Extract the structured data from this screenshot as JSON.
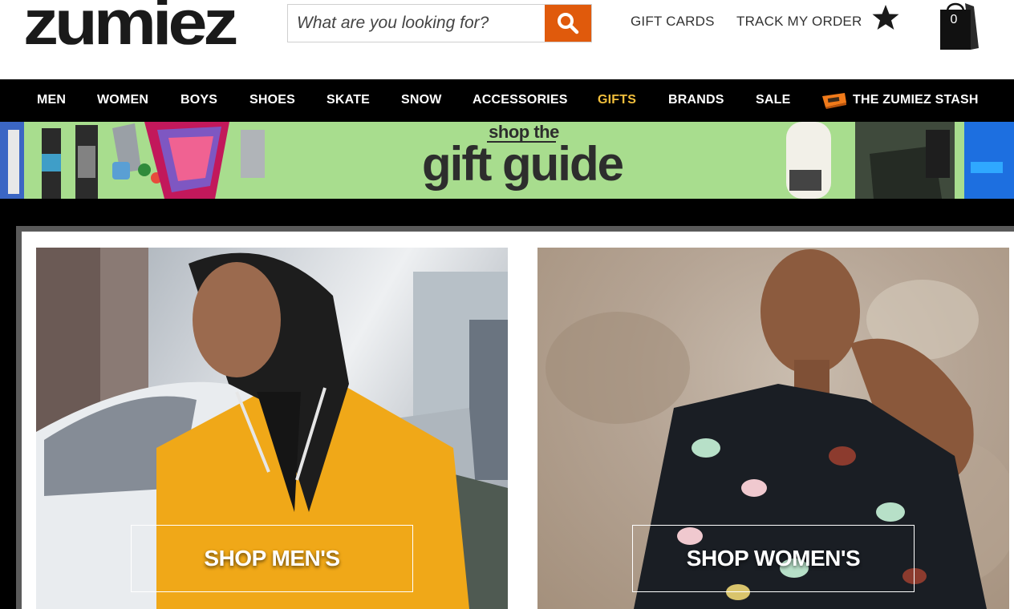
{
  "header": {
    "logo": "zumiez",
    "search_placeholder": "What are you looking for?",
    "links": [
      "GIFT CARDS",
      "TRACK MY ORDER"
    ],
    "cart_count": "0"
  },
  "nav": {
    "items": [
      "MEN",
      "WOMEN",
      "BOYS",
      "SHOES",
      "SKATE",
      "SNOW",
      "ACCESSORIES",
      "GIFTS",
      "BRANDS",
      "SALE",
      "THE ZUMIEZ STASH"
    ]
  },
  "banner": {
    "line1": "shop the",
    "line2": "gift guide"
  },
  "tiles": {
    "men_label": "SHOP MEN'S",
    "women_label": "SHOP WOMEN'S"
  },
  "colors": {
    "accent": "#e05a0c",
    "gifts": "#f2bf3c",
    "banner": "#a8dd8e"
  },
  "icons": {
    "search": "magnifier-icon",
    "favorites": "star-icon",
    "cart": "shopping-bag-icon",
    "stash": "stash-icon"
  }
}
